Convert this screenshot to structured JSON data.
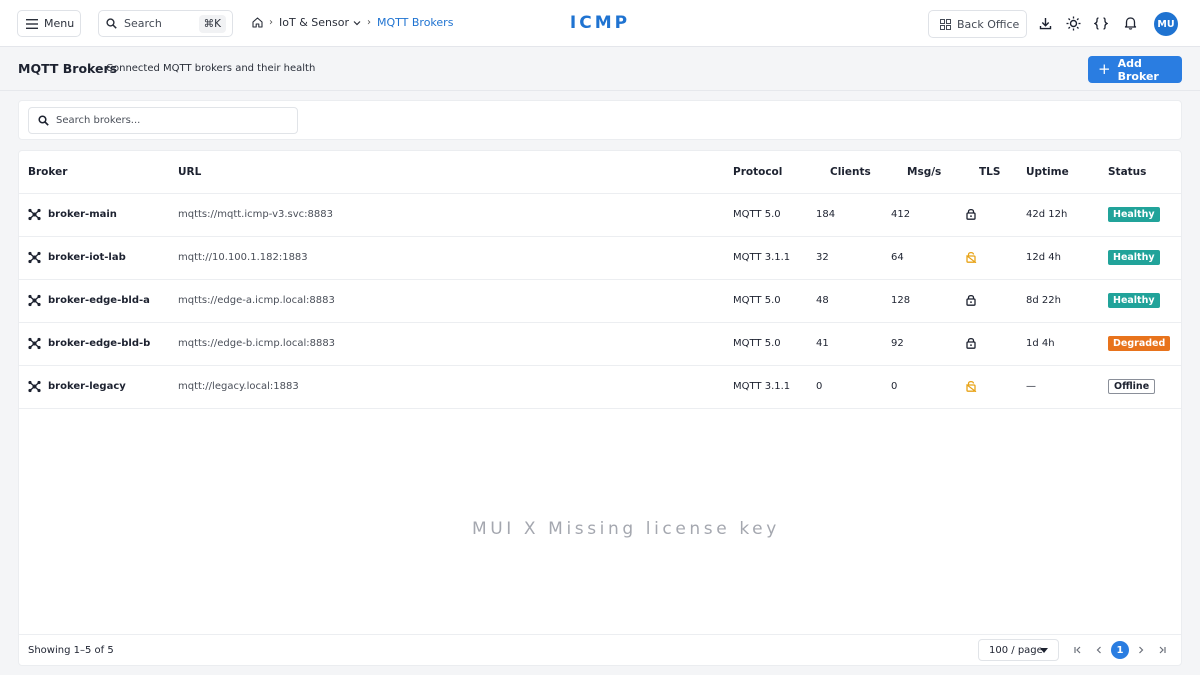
{
  "topbar": {
    "menu_label": "Menu",
    "search_label": "Search",
    "search_shortcut": "⌘K",
    "breadcrumb": {
      "section": "IoT & Sensor",
      "current": "MQTT Brokers"
    },
    "logo": "ICMP",
    "back_office_label": "Back Office",
    "avatar_initials": "MU"
  },
  "page": {
    "title": "MQTT Brokers",
    "subtitle": "Connected MQTT brokers and their health",
    "add_button_label": "Add Broker"
  },
  "search": {
    "placeholder": "Search brokers..."
  },
  "table": {
    "columns": [
      "Broker",
      "URL",
      "Protocol",
      "Clients",
      "Msg/s",
      "TLS",
      "Uptime",
      "Status"
    ],
    "rows": [
      {
        "broker": "broker-main",
        "url": "mqtts://mqtt.icmp-v3.svc:8883",
        "protocol": "MQTT 5.0",
        "clients": "184",
        "msgs": "412",
        "tls": "locked",
        "uptime": "42d 12h",
        "status": "Healthy"
      },
      {
        "broker": "broker-iot-lab",
        "url": "mqtt://10.100.1.182:1883",
        "protocol": "MQTT 3.1.1",
        "clients": "32",
        "msgs": "64",
        "tls": "unlocked",
        "uptime": "12d 4h",
        "status": "Healthy"
      },
      {
        "broker": "broker-edge-bld-a",
        "url": "mqtts://edge-a.icmp.local:8883",
        "protocol": "MQTT 5.0",
        "clients": "48",
        "msgs": "128",
        "tls": "locked",
        "uptime": "8d 22h",
        "status": "Healthy"
      },
      {
        "broker": "broker-edge-bld-b",
        "url": "mqtts://edge-b.icmp.local:8883",
        "protocol": "MQTT 5.0",
        "clients": "41",
        "msgs": "92",
        "tls": "locked",
        "uptime": "1d 4h",
        "status": "Degraded"
      },
      {
        "broker": "broker-legacy",
        "url": "mqtt://legacy.local:1883",
        "protocol": "MQTT 3.1.1",
        "clients": "0",
        "msgs": "0",
        "tls": "unlocked",
        "uptime": "—",
        "status": "Offline"
      }
    ]
  },
  "watermark": "MUI X Missing license key",
  "footer": {
    "showing": "Showing 1–5 of 5",
    "per_page": "100 / page",
    "current_page": "1"
  },
  "colors": {
    "accent": "#1f73d1",
    "healthy": "#21a39a",
    "degraded": "#e8731c",
    "tls_warning": "#e8a317"
  }
}
